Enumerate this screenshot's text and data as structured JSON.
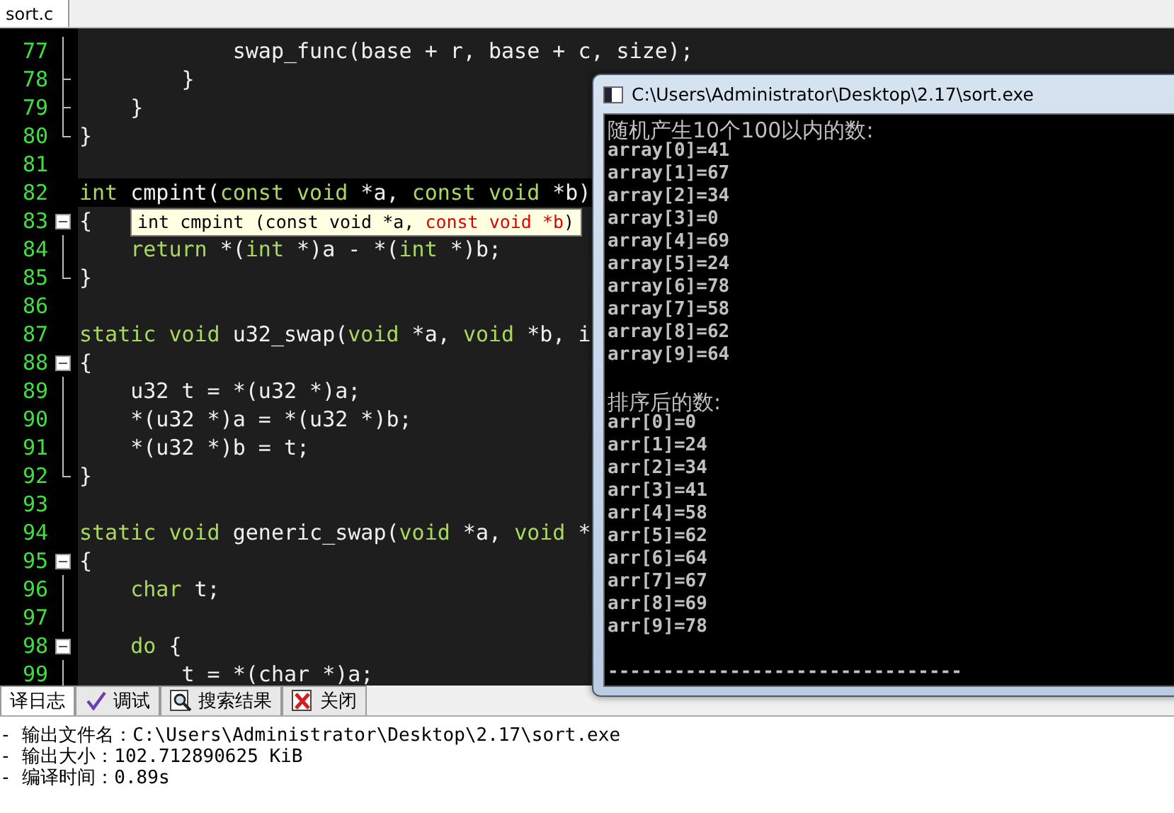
{
  "file_tabs": [
    {
      "label": "sort.c",
      "selected": true
    }
  ],
  "editor": {
    "lines": [
      {
        "number": "77",
        "kind": "fold-body",
        "current": false,
        "code": [
          {
            "kind": "id",
            "text": "            swap_func(base + r, base + c, size);"
          }
        ]
      },
      {
        "number": "78",
        "kind": "fold-branch",
        "current": false,
        "code": [
          {
            "kind": "id",
            "text": "        }"
          }
        ]
      },
      {
        "number": "79",
        "kind": "fold-branch",
        "current": false,
        "code": [
          {
            "kind": "id",
            "text": "    }"
          }
        ]
      },
      {
        "number": "80",
        "kind": "fold-end",
        "current": false,
        "code": [
          {
            "kind": "id",
            "text": "}"
          }
        ]
      },
      {
        "number": "81",
        "kind": "plain",
        "current": false
      },
      {
        "number": "82",
        "kind": "plain",
        "current": true,
        "code": [
          {
            "kind": "kw",
            "text": "int"
          },
          {
            "kind": "id",
            "text": " cmpint("
          },
          {
            "kind": "kw",
            "text": "const void"
          },
          {
            "kind": "id",
            "text": " *a, "
          },
          {
            "kind": "kw",
            "text": "const void"
          },
          {
            "kind": "id",
            "text": " *b)"
          }
        ]
      },
      {
        "number": "83",
        "kind": "fold-start",
        "current": false,
        "code": [
          {
            "kind": "id",
            "text": "{"
          }
        ]
      },
      {
        "number": "84",
        "kind": "fold-body",
        "current": false,
        "code": [
          {
            "kind": "kw",
            "text": "    return"
          },
          {
            "kind": "id",
            "text": " *("
          },
          {
            "kind": "kw",
            "text": "int"
          },
          {
            "kind": "id",
            "text": " *)a - *("
          },
          {
            "kind": "kw",
            "text": "int"
          },
          {
            "kind": "id",
            "text": " *)b;"
          }
        ]
      },
      {
        "number": "85",
        "kind": "fold-end",
        "current": false,
        "code": [
          {
            "kind": "id",
            "text": "}"
          }
        ]
      },
      {
        "number": "86",
        "kind": "plain",
        "current": false
      },
      {
        "number": "87",
        "kind": "plain",
        "current": false,
        "code": [
          {
            "kind": "kw",
            "text": "static void"
          },
          {
            "kind": "id",
            "text": " u32_swap("
          },
          {
            "kind": "kw",
            "text": "void"
          },
          {
            "kind": "id",
            "text": " *a, "
          },
          {
            "kind": "kw",
            "text": "void"
          },
          {
            "kind": "id",
            "text": " *b, i"
          }
        ]
      },
      {
        "number": "88",
        "kind": "fold-start",
        "current": false,
        "code": [
          {
            "kind": "id",
            "text": "{"
          }
        ]
      },
      {
        "number": "89",
        "kind": "fold-body",
        "current": false,
        "code": [
          {
            "kind": "id",
            "text": "    u32 t = *(u32 *)a;"
          }
        ]
      },
      {
        "number": "90",
        "kind": "fold-body",
        "current": false,
        "code": [
          {
            "kind": "id",
            "text": "    *(u32 *)a = *(u32 *)b;"
          }
        ]
      },
      {
        "number": "91",
        "kind": "fold-body",
        "current": false,
        "code": [
          {
            "kind": "id",
            "text": "    *(u32 *)b = t;"
          }
        ]
      },
      {
        "number": "92",
        "kind": "fold-end",
        "current": false,
        "code": [
          {
            "kind": "id",
            "text": "}"
          }
        ]
      },
      {
        "number": "93",
        "kind": "plain",
        "current": false
      },
      {
        "number": "94",
        "kind": "plain",
        "current": false,
        "code": [
          {
            "kind": "kw",
            "text": "static void"
          },
          {
            "kind": "id",
            "text": " generic_swap("
          },
          {
            "kind": "kw",
            "text": "void"
          },
          {
            "kind": "id",
            "text": " *a, "
          },
          {
            "kind": "kw",
            "text": "void"
          },
          {
            "kind": "id",
            "text": " *"
          }
        ]
      },
      {
        "number": "95",
        "kind": "fold-start",
        "current": false,
        "code": [
          {
            "kind": "id",
            "text": "{"
          }
        ]
      },
      {
        "number": "96",
        "kind": "fold-body",
        "current": false,
        "code": [
          {
            "kind": "kw",
            "text": "    char"
          },
          {
            "kind": "id",
            "text": " t;"
          }
        ]
      },
      {
        "number": "97",
        "kind": "fold-body",
        "current": false
      },
      {
        "number": "98",
        "kind": "fold-start",
        "current": false,
        "code": [
          {
            "kind": "kw",
            "text": "    do"
          },
          {
            "kind": "id",
            "text": " {"
          }
        ]
      },
      {
        "number": "99",
        "kind": "fold-body",
        "current": false,
        "code": [
          {
            "kind": "id",
            "text": "        t = *(char *)a;"
          }
        ]
      }
    ],
    "tooltip": [
      {
        "kind": "plain",
        "text": "int cmpint (const void *a, "
      },
      {
        "kind": "active",
        "text": "const void *b"
      },
      {
        "kind": "plain",
        "text": ")"
      }
    ]
  },
  "console": {
    "title": "C:\\Users\\Administrator\\Desktop\\2.17\\sort.exe",
    "lines": [
      {
        "kind": "heading",
        "text": "随机产生10个100以内的数:"
      },
      {
        "kind": "output",
        "text": "array[0]=41"
      },
      {
        "kind": "output",
        "text": "array[1]=67"
      },
      {
        "kind": "output",
        "text": "array[2]=34"
      },
      {
        "kind": "output",
        "text": "array[3]=0"
      },
      {
        "kind": "output",
        "text": "array[4]=69"
      },
      {
        "kind": "output",
        "text": "array[5]=24"
      },
      {
        "kind": "output",
        "text": "array[6]=78"
      },
      {
        "kind": "output",
        "text": "array[7]=58"
      },
      {
        "kind": "output",
        "text": "array[8]=62"
      },
      {
        "kind": "output",
        "text": "array[9]=64"
      },
      {
        "kind": "blank"
      },
      {
        "kind": "heading",
        "text": "排序后的数:"
      },
      {
        "kind": "output",
        "text": "arr[0]=0"
      },
      {
        "kind": "output",
        "text": "arr[1]=24"
      },
      {
        "kind": "output",
        "text": "arr[2]=34"
      },
      {
        "kind": "output",
        "text": "arr[3]=41"
      },
      {
        "kind": "output",
        "text": "arr[4]=58"
      },
      {
        "kind": "output",
        "text": "arr[5]=62"
      },
      {
        "kind": "output",
        "text": "arr[6]=64"
      },
      {
        "kind": "output",
        "text": "arr[7]=67"
      },
      {
        "kind": "output",
        "text": "arr[8]=69"
      },
      {
        "kind": "output",
        "text": "arr[9]=78"
      },
      {
        "kind": "blank"
      },
      {
        "kind": "output",
        "text": "--------------------------------"
      }
    ]
  },
  "bottom_tabs": [
    {
      "label": "译日志",
      "selected": true
    },
    {
      "label": "调试",
      "selected": false
    },
    {
      "label": "搜索结果",
      "selected": false
    },
    {
      "label": "关闭",
      "selected": false
    }
  ],
  "log": [
    "- 输出文件名：C:\\Users\\Administrator\\Desktop\\2.17\\sort.exe",
    "- 输出大小：102.712890625 KiB",
    "- 编译时间：0.89s"
  ]
}
